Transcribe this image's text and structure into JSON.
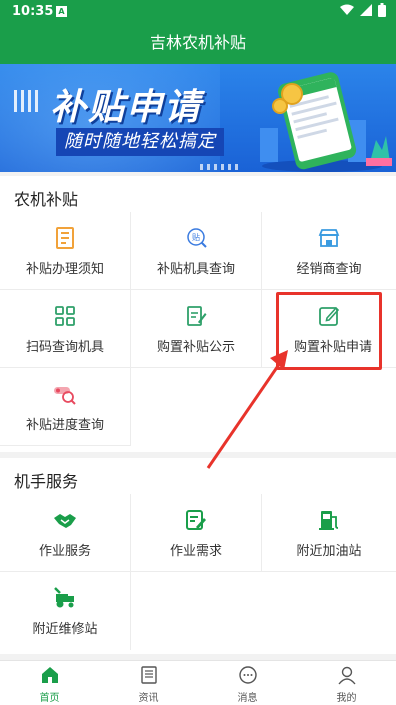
{
  "status": {
    "time": "10:35",
    "notification_glyph": "A"
  },
  "header": {
    "title": "吉林农机补贴"
  },
  "banner": {
    "title": "补贴申请",
    "subtitle": "随时随地轻松搞定"
  },
  "sections": [
    {
      "title": "农机补贴",
      "items": [
        {
          "label": "补贴办理须知",
          "icon": "document-list-icon"
        },
        {
          "label": "补贴机具查询",
          "icon": "subsidy-search-icon"
        },
        {
          "label": "经销商查询",
          "icon": "store-icon"
        },
        {
          "label": "扫码查询机具",
          "icon": "scan-grid-icon"
        },
        {
          "label": "购置补贴公示",
          "icon": "announcement-edit-icon"
        },
        {
          "label": "购置补贴申请",
          "icon": "edit-form-icon"
        },
        {
          "label": "补贴进度查询",
          "icon": "progress-search-icon"
        }
      ]
    },
    {
      "title": "机手服务",
      "items": [
        {
          "label": "作业服务",
          "icon": "handshake-icon"
        },
        {
          "label": "作业需求",
          "icon": "clipboard-edit-icon"
        },
        {
          "label": "附近加油站",
          "icon": "fuel-pump-icon"
        },
        {
          "label": "附近维修站",
          "icon": "tractor-repair-icon"
        }
      ]
    }
  ],
  "tabbar": [
    {
      "label": "首页",
      "icon": "home-icon",
      "active": true
    },
    {
      "label": "资讯",
      "icon": "news-icon",
      "active": false
    },
    {
      "label": "消息",
      "icon": "message-icon",
      "active": false
    },
    {
      "label": "我的",
      "icon": "user-icon",
      "active": false
    }
  ],
  "colors": {
    "primary": "#1a9e4a",
    "banner_blue": "#1a62d6",
    "orange_icon": "#f1a23a",
    "highlight_red": "#e8332b"
  }
}
